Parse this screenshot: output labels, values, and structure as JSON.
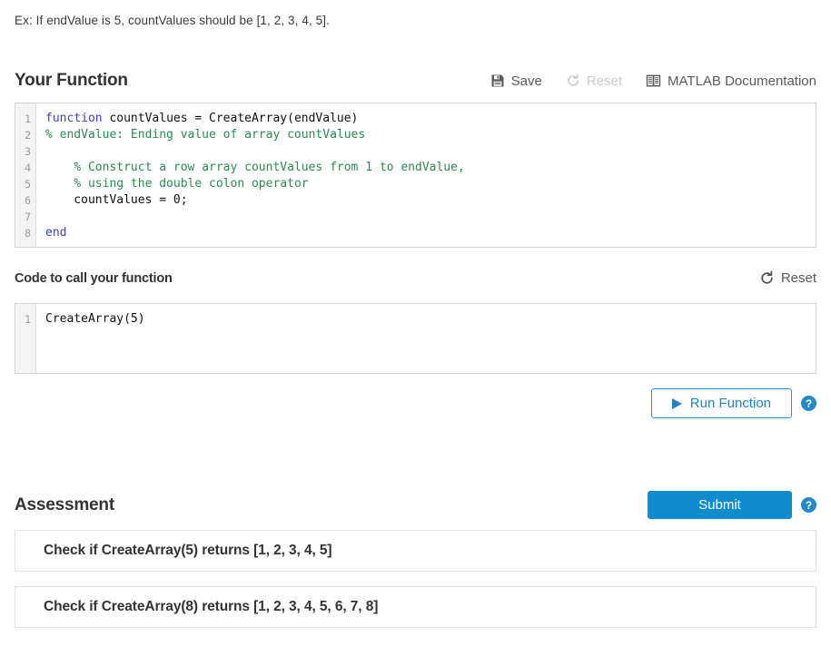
{
  "intro": {
    "text": "Ex: If endValue is 5, countValues should be [1, 2, 3, 4, 5]."
  },
  "your_function": {
    "title": "Your Function",
    "actions": {
      "save": {
        "label": "Save",
        "icon": "save-floppy-icon",
        "enabled": true
      },
      "reset": {
        "label": "Reset",
        "icon": "reset-refresh-icon",
        "enabled": false
      },
      "docs": {
        "label": "MATLAB Documentation",
        "icon": "book-icon",
        "enabled": true
      }
    },
    "editor": {
      "line_numbers": [
        "1",
        "2",
        "3",
        "4",
        "5",
        "6",
        "7",
        "8"
      ],
      "lines": [
        "function countValues = CreateArray(endValue)",
        "% endValue: Ending value of array countValues",
        "",
        "    % Construct a row array countValues from 1 to endValue,",
        "    % using the double colon operator",
        "    countValues = 0;",
        "",
        "end"
      ]
    }
  },
  "call_code": {
    "title": "Code to call your function",
    "actions": {
      "reset": {
        "label": "Reset",
        "icon": "reset-refresh-icon",
        "enabled": true
      }
    },
    "editor": {
      "line_numbers": [
        "1"
      ],
      "lines": [
        "CreateArray(5)"
      ]
    },
    "run_button": {
      "label": "Run Function",
      "icon": "play-icon"
    },
    "help": {
      "label": "?"
    }
  },
  "assessment": {
    "title": "Assessment",
    "submit_label": "Submit",
    "help": {
      "label": "?"
    },
    "tests": [
      {
        "label": "Check if CreateArray(5) returns [1, 2, 3, 4, 5]"
      },
      {
        "label": "Check if CreateArray(8) returns [1, 2, 3, 4, 5, 6, 7, 8]"
      }
    ]
  },
  "colors": {
    "accent_blue": "#0f8cce",
    "run_border": "#1a9ad7",
    "keyword": "#3f3fbf",
    "comment": "#2c8a4f",
    "muted": "#cbcbcb"
  }
}
